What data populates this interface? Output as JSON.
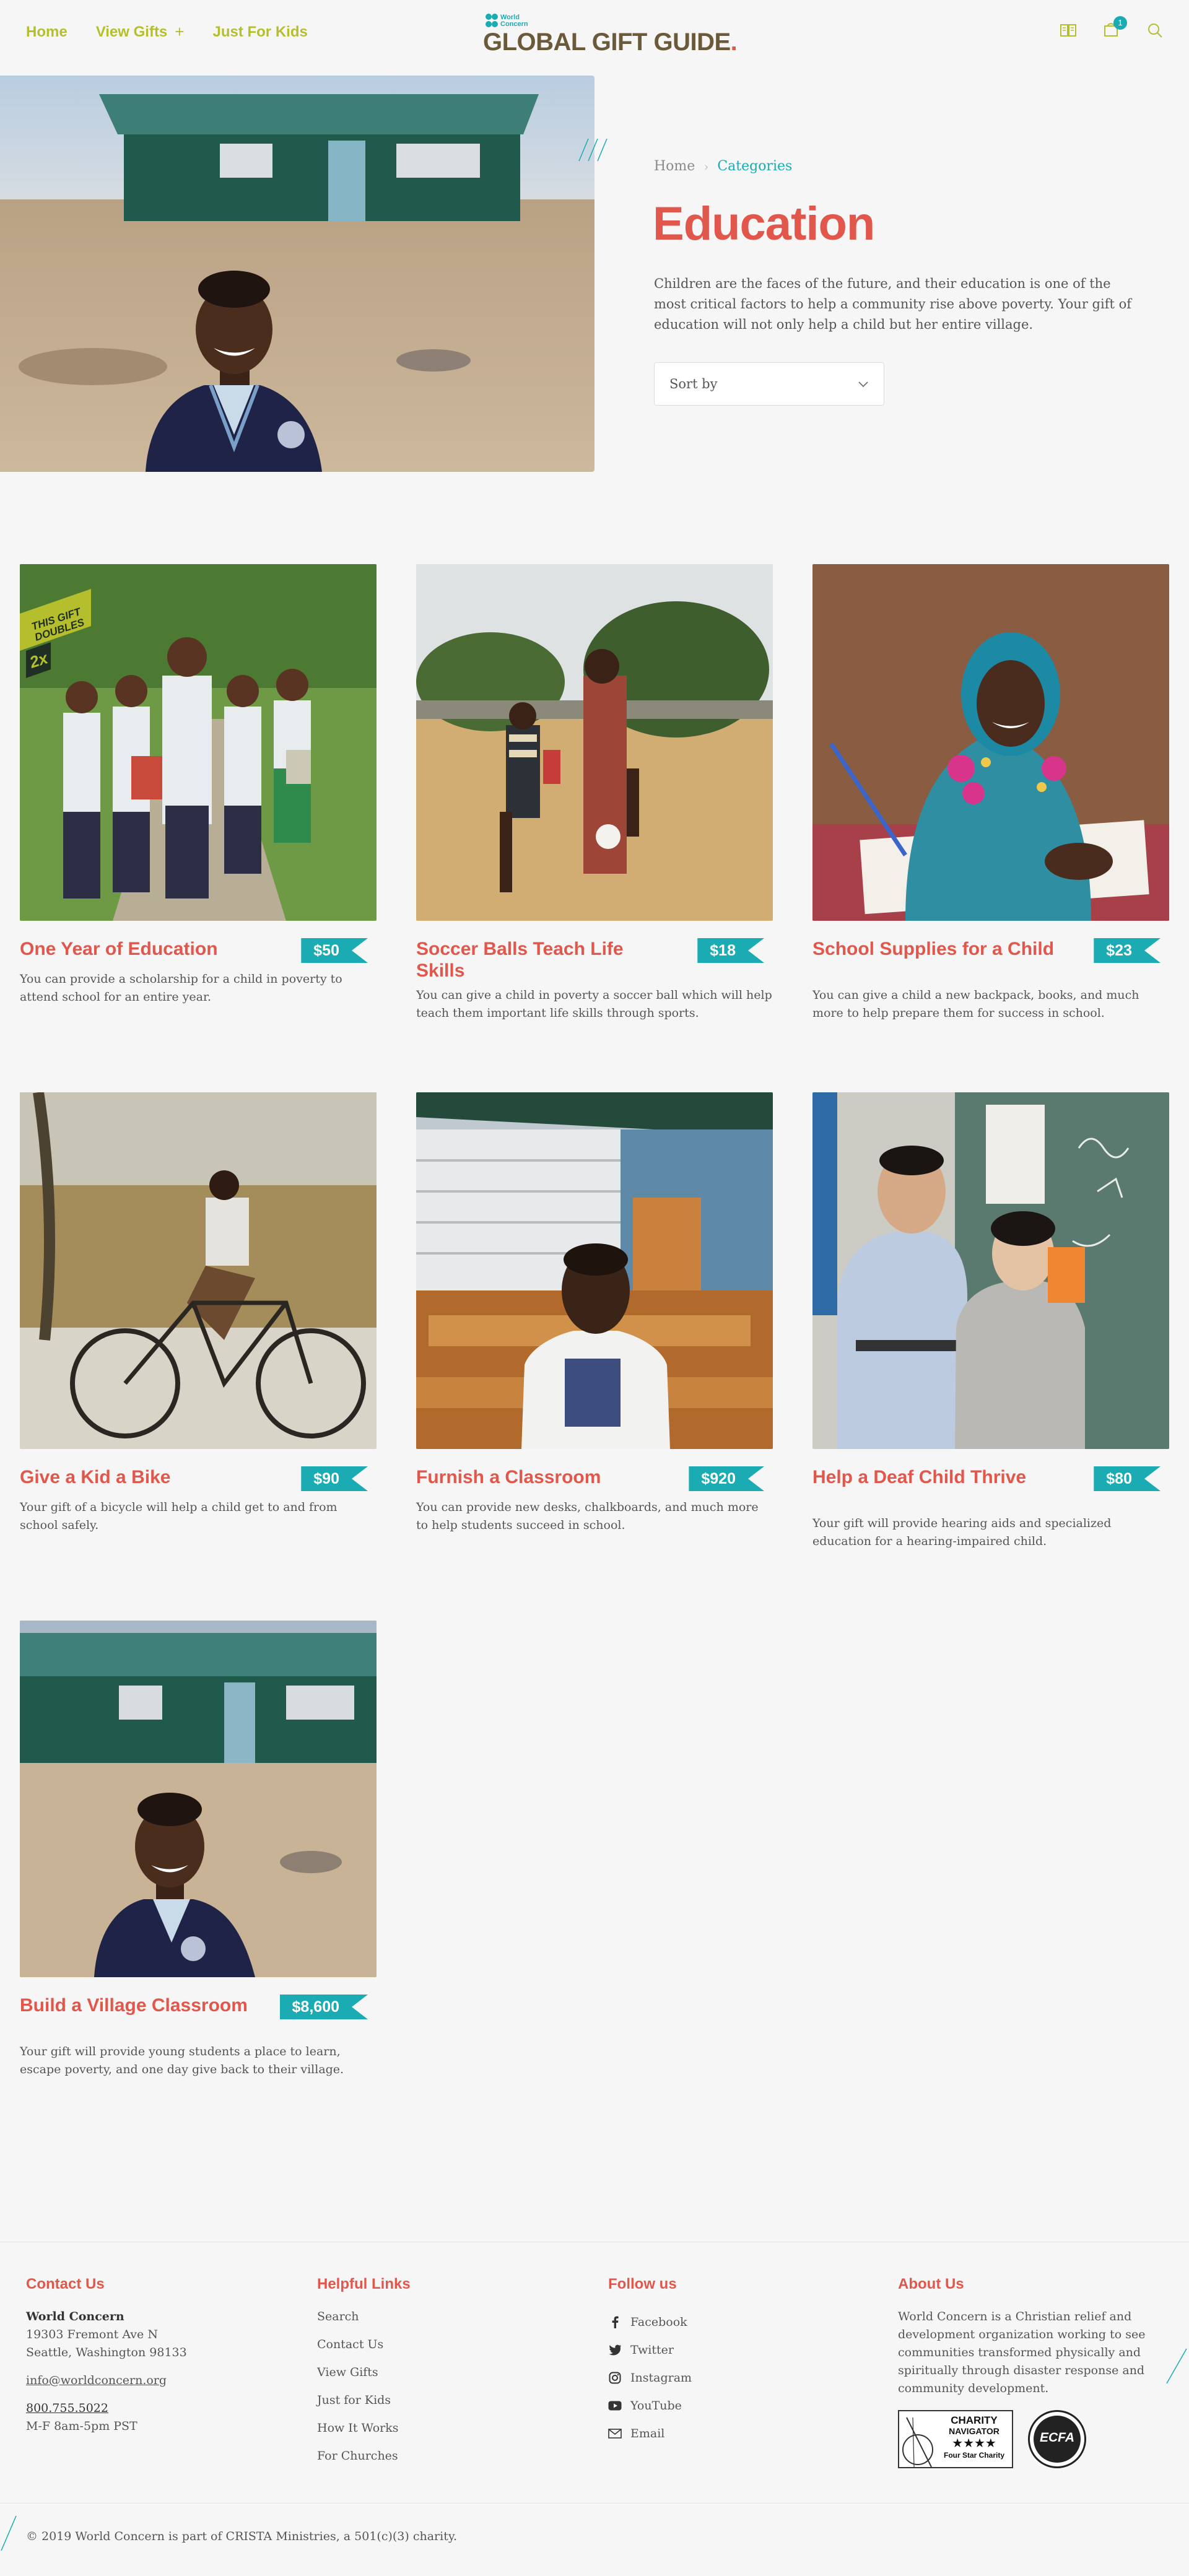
{
  "header": {
    "nav": [
      {
        "label": "Home"
      },
      {
        "label": "View Gifts",
        "suffix": "+"
      },
      {
        "label": "Just For Kids"
      }
    ],
    "logo": {
      "brand_small": "World Concern",
      "title": "GLOBAL GIFT GUIDE",
      "dot": "."
    },
    "cart_count": "1",
    "icons": [
      "catalog-icon",
      "cart-icon",
      "search-icon"
    ]
  },
  "breadcrumb": {
    "home": "Home",
    "current": "Categories"
  },
  "page": {
    "title": "Education",
    "intro": "Children are the faces of the future, and their education is one of the most critical factors to help a community rise above poverty. Your gift of education will not only help a child but her entire village.",
    "sort_label": "Sort by"
  },
  "gifts": [
    {
      "title": "One Year of Education",
      "price": "$50",
      "desc": "You can provide a scholarship for a child in poverty to attend school for an entire year.",
      "badge_line1": "THIS GIFT",
      "badge_line2": "DOUBLES",
      "badge_line3": "2x"
    },
    {
      "title": "Soccer Balls Teach Life Skills",
      "price": "$18",
      "desc": "You can give a child in poverty a soccer ball which will help teach them important life skills through sports."
    },
    {
      "title": "School Supplies for a Child",
      "price": "$23",
      "desc": "You can give a child a new backpack, books, and much more to help prepare them for success in school."
    },
    {
      "title": "Give a Kid a Bike",
      "price": "$90",
      "desc": "Your gift of a bicycle will help a child get to and from school safely."
    },
    {
      "title": "Furnish a Classroom",
      "price": "$920",
      "desc": "You can provide new desks, chalkboards, and much more to help students succeed in school."
    },
    {
      "title": "Help a Deaf Child Thrive",
      "price": "$80",
      "desc": "Your gift will provide hearing aids and specialized education for a hearing-impaired child."
    },
    {
      "title": "Build a Village Classroom",
      "price": "$8,600",
      "desc": "Your gift will provide young students a place to learn, escape poverty, and one day give back to their village."
    }
  ],
  "footer": {
    "contact": {
      "heading": "Contact Us",
      "org": "World Concern",
      "address1": "19303 Fremont Ave N",
      "address2": "Seattle, Washington 98133",
      "email": "info@worldconcern.org",
      "phone": "800.755.5022",
      "hours": "M-F 8am-5pm PST"
    },
    "links": {
      "heading": "Helpful Links",
      "items": [
        "Search",
        "Contact Us",
        "View Gifts",
        "Just for Kids",
        "How It Works",
        "For Churches"
      ]
    },
    "follow": {
      "heading": "Follow us",
      "items": [
        {
          "label": "Facebook",
          "icon": "facebook-icon"
        },
        {
          "label": "Twitter",
          "icon": "twitter-icon"
        },
        {
          "label": "Instagram",
          "icon": "instagram-icon"
        },
        {
          "label": "YouTube",
          "icon": "youtube-icon"
        },
        {
          "label": "Email",
          "icon": "email-icon"
        }
      ]
    },
    "about": {
      "heading": "About Us",
      "text": "World Concern is a Christian relief and development organization working to see communities transformed physically and spiritually through disaster response and community development.",
      "cn_line1": "CHARITY",
      "cn_line2": "NAVIGATOR",
      "cn_stars": "★★★★",
      "cn_line3": "Four Star Charity",
      "ecfa": "ECFA"
    },
    "copyright": "© 2019 World Concern is part of CRISTA Ministries, a 501(c)(3) charity."
  },
  "colors": {
    "accent": "#e2574c",
    "teal": "#1aabb3",
    "nav": "#b5bf2e",
    "brand_brown": "#6a5a3a"
  }
}
